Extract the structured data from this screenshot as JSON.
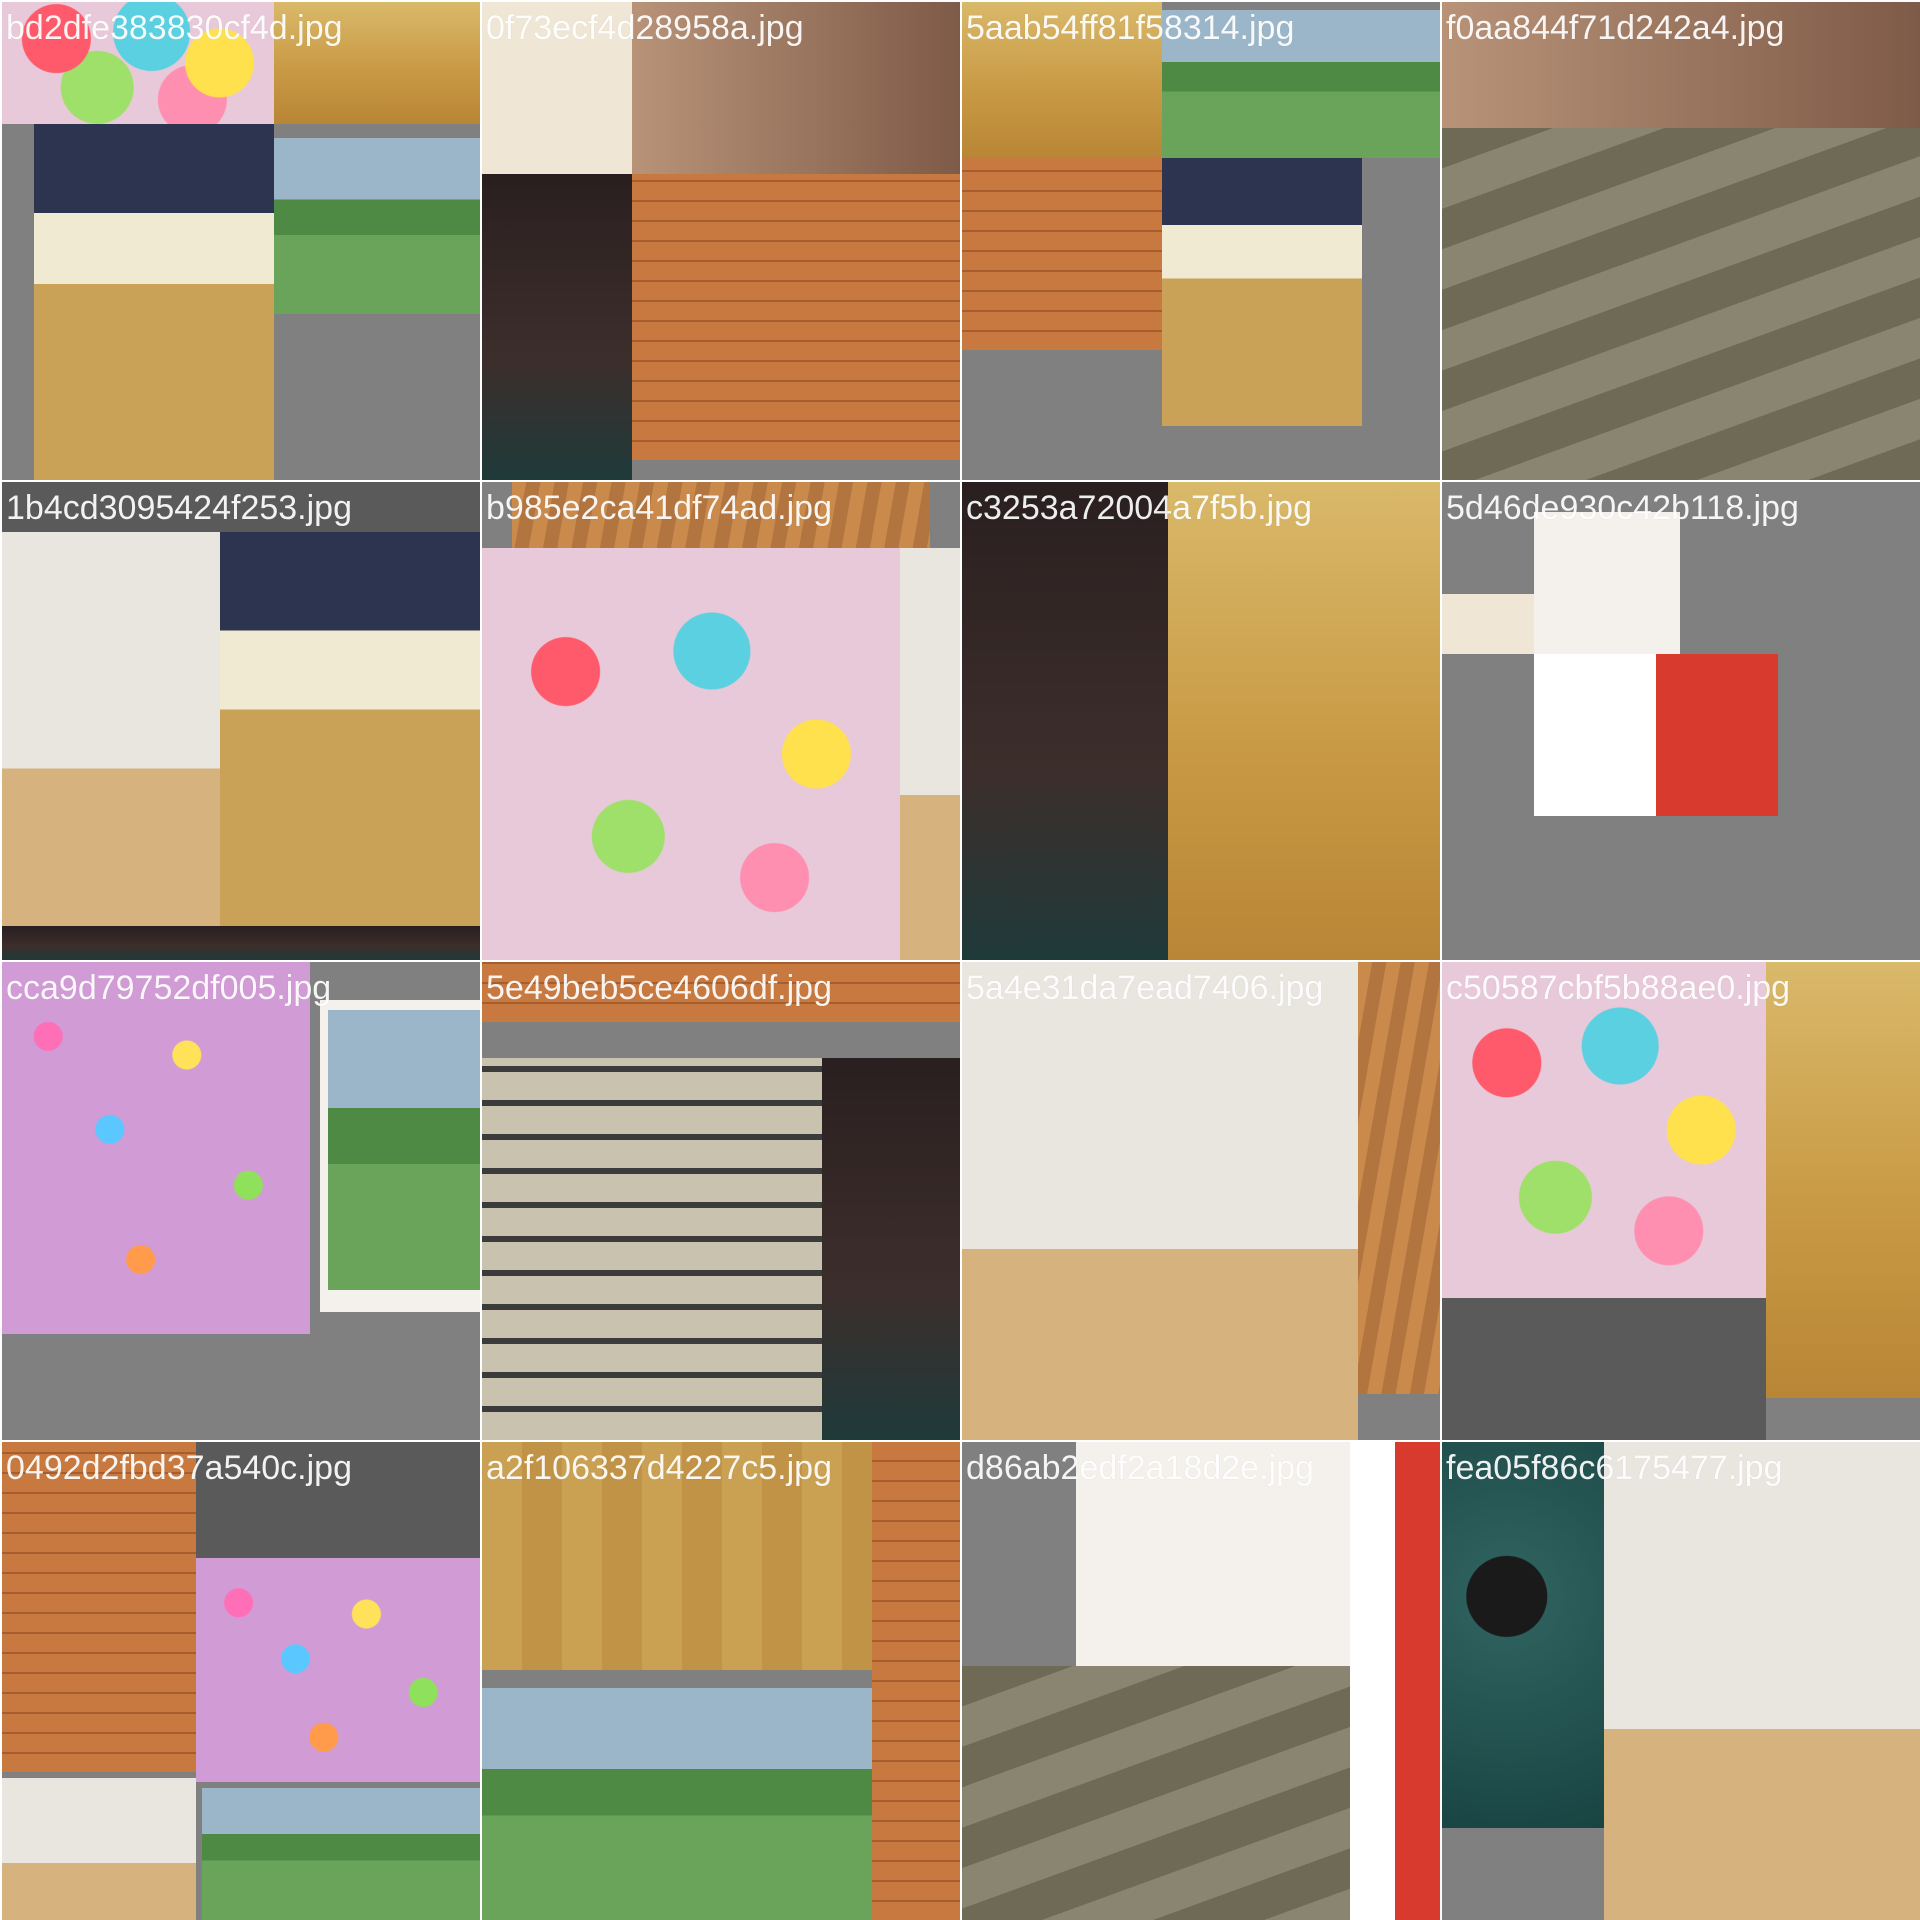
{
  "colors": {
    "tile_background": "#808080",
    "label_color": "#ffffff",
    "grid_gutter": "#ffffff"
  },
  "tiles": [
    {
      "label": "bd2dfe383830cf4d.jpg"
    },
    {
      "label": "0f73ecf4d28958a.jpg"
    },
    {
      "label": "5aab54ff81f58314.jpg"
    },
    {
      "label": "f0aa844f71d242a4.jpg"
    },
    {
      "label": "1b4cd3095424f253.jpg"
    },
    {
      "label": "b985e2ca41df74ad.jpg"
    },
    {
      "label": "c3253a72004a7f5b.jpg"
    },
    {
      "label": "5d46de930c42b118.jpg"
    },
    {
      "label": "cca9d79752df005.jpg"
    },
    {
      "label": "5e49beb5ce4606df.jpg"
    },
    {
      "label": "5a4e31da7ead7406.jpg"
    },
    {
      "label": "c50587cbf5b88ae0.jpg"
    },
    {
      "label": "0492d2fbd37a540c.jpg"
    },
    {
      "label": "a2f106337d4227c5.jpg"
    },
    {
      "label": "d86ab2edf2a18d2e.jpg"
    },
    {
      "label": "fea05f86c6175477.jpg"
    }
  ]
}
